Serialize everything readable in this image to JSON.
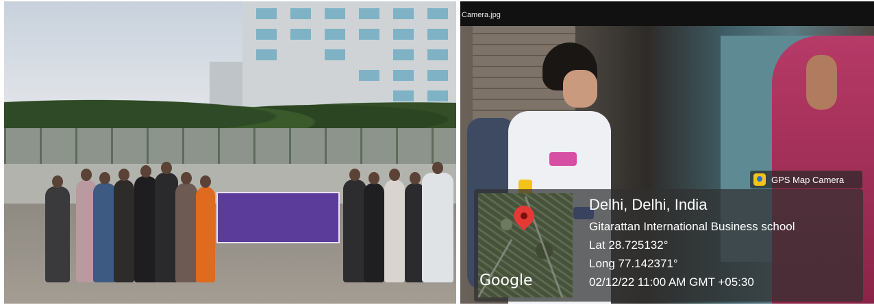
{
  "right_photo": {
    "title_bar": "Camera.jpg"
  },
  "gps_overlay": {
    "app_badge": "GPS Map Camera",
    "app_badge_icon": "gps-map-camera-icon",
    "map_logo": "Google",
    "place": "Delhi, Delhi, India",
    "name": "Gitarattan International Business school",
    "lat": "Lat 28.725132°",
    "long": "Long 77.142371°",
    "datetime": "02/12/22 11:00 AM GMT +05:30",
    "pin_color": "#e53935"
  },
  "left_photo": {
    "banner_colors": {
      "banner": "#5b3c9a"
    }
  }
}
